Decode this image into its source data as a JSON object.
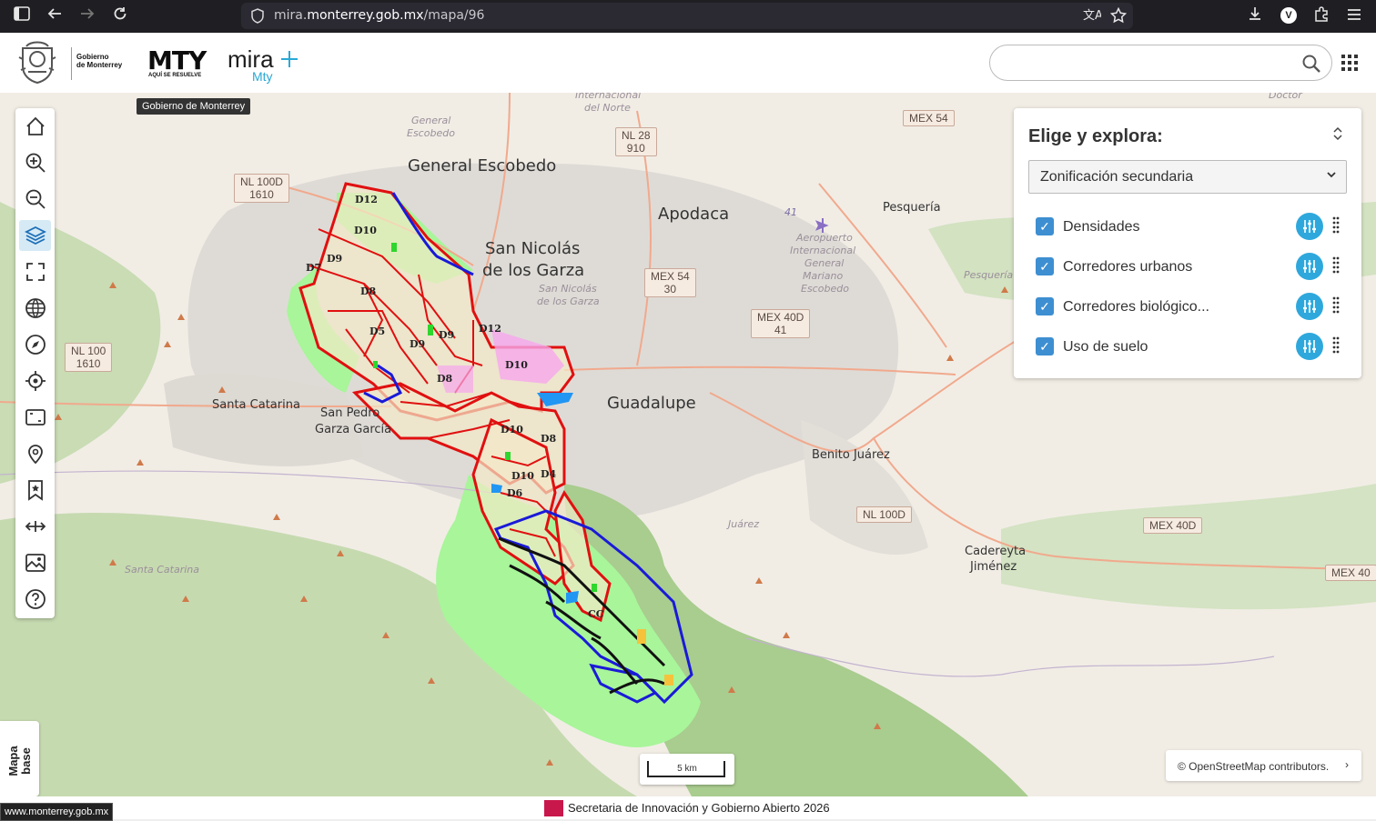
{
  "browser": {
    "url_prefix": "mira.",
    "url_domain": "monterrey.gob.mx",
    "url_path": "/mapa/96",
    "profile_initial": "V"
  },
  "header": {
    "gov_line1": "Gobierno",
    "gov_line2": "de Monterrey",
    "mty": "MTY",
    "mty_tagline": "AQUÍ SE RESUELVE",
    "mira": "mira",
    "mira_sub": "Mty",
    "search_placeholder": ""
  },
  "tooltip": "Gobierno de Monterrey",
  "toolbar": {
    "items": [
      "home-icon",
      "zoom-in-icon",
      "zoom-out-icon",
      "layers-icon",
      "fullscreen-icon",
      "globe-icon",
      "compass-icon",
      "locate-icon",
      "map-frame-icon",
      "marker-icon",
      "bookmark-icon",
      "measure-icon",
      "image-icon",
      "help-icon"
    ],
    "active": "layers-icon"
  },
  "panel": {
    "title": "Elige y explora:",
    "selected": "Zonificación secundaria",
    "layers": [
      {
        "label": "Densidades",
        "checked": true
      },
      {
        "label": "Corredores urbanos",
        "checked": true
      },
      {
        "label": "Corredores biológico...",
        "checked": true
      },
      {
        "label": "Uso de suelo",
        "checked": true
      }
    ]
  },
  "map": {
    "cities": [
      "General Escobedo",
      "Apodaca",
      "San Nicolás",
      "de los Garza",
      "Guadalupe",
      "Santa Catarina",
      "San Pedro",
      "Garza García",
      "Pesquería",
      "Benito Juárez",
      "Cadereyta",
      "Jiménez"
    ],
    "italic_labels": [
      "General",
      "Escobedo",
      "San Nicolás",
      "de los Garza",
      "Pesquería",
      "Juárez",
      "Santa Catarina",
      "Aeropuerto",
      "Internacional",
      "General",
      "Mariano",
      "Escobedo",
      "Internacional",
      "del Norte",
      "Doctor"
    ],
    "shields": [
      "MEX 54",
      "NL 28",
      "910",
      "NL 100D",
      "1610",
      "MEX 54",
      "30",
      "MEX 40D",
      "41",
      "NL 100",
      "1610",
      "NL 100D",
      "MEX 40D",
      "MEX 40"
    ],
    "district_labels": [
      "D12",
      "D10",
      "D9",
      "D7",
      "D8",
      "D9",
      "D10",
      "D8",
      "D12",
      "D9",
      "D10",
      "D8",
      "D5",
      "D10",
      "D6",
      "D4",
      "CC"
    ],
    "zone_number": "41"
  },
  "mapbase": "Mapa base",
  "scale": "5 km",
  "attribution": "© OpenStreetMap contributors.",
  "attribution_toggle": "›",
  "status_url": "www.monterrey.gob.mx",
  "footer": "Secretaria de Innovación y Gobierno Abierto 2026"
}
